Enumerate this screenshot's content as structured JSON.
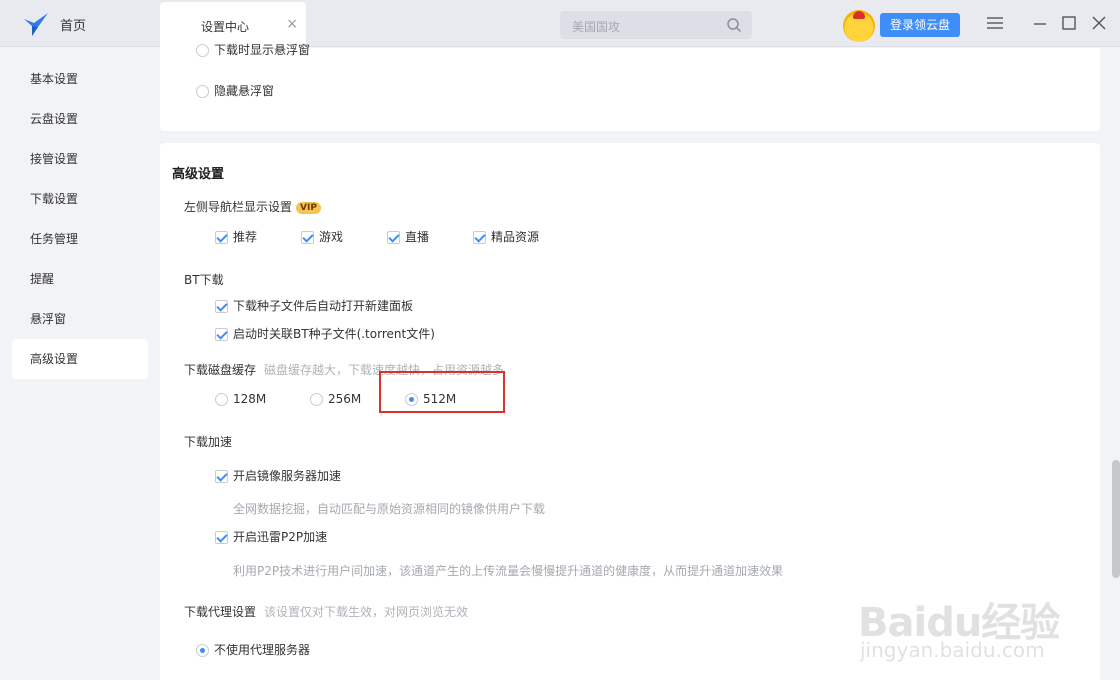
{
  "header": {
    "home_label": "首页",
    "tab_title": "设置中心",
    "tab_close": "×",
    "search_placeholder": "美国国攻",
    "cloud_button": "登录领云盘"
  },
  "sidebar": {
    "items": [
      {
        "label": "基本设置"
      },
      {
        "label": "云盘设置"
      },
      {
        "label": "接管设置"
      },
      {
        "label": "下载设置"
      },
      {
        "label": "任务管理"
      },
      {
        "label": "提醒"
      },
      {
        "label": "悬浮窗"
      },
      {
        "label": "高级设置",
        "active": true
      }
    ]
  },
  "floating": {
    "partial_option": "下载时显示悬浮窗",
    "hide_option": "隐藏悬浮窗"
  },
  "advanced": {
    "title": "高级设置",
    "nav": {
      "label": "左侧导航栏显示设置",
      "vip": "VIP",
      "options": [
        "推荐",
        "游戏",
        "直播",
        "精品资源"
      ]
    },
    "bt": {
      "label": "BT下载",
      "options": [
        "下载种子文件后自动打开新建面板",
        "启动时关联BT种子文件(.torrent文件)"
      ]
    },
    "cache": {
      "label": "下载磁盘缓存",
      "hint": "磁盘缓存越大，下载速度越快，占用资源越多",
      "options": [
        "128M",
        "256M",
        "512M"
      ],
      "selected": "512M"
    },
    "accel": {
      "label": "下载加速",
      "mirror": "开启镜像服务器加速",
      "mirror_desc": "全网数据挖掘，自动匹配与原始资源相同的镜像供用户下载",
      "p2p": "开启迅雷P2P加速",
      "p2p_desc": "利用P2P技术进行用户间加速，该通道产生的上传流量会慢慢提升通道的健康度，从而提升通道加速效果"
    },
    "proxy": {
      "label": "下载代理设置",
      "hint": "该设置仅对下载生效，对网页浏览无效",
      "option": "不使用代理服务器"
    }
  },
  "watermark": {
    "text": "Baidu经验",
    "sub": "jingyan.baidu.com"
  },
  "colors": {
    "accent": "#3f8ef7",
    "highlight_box": "#d7332c"
  }
}
